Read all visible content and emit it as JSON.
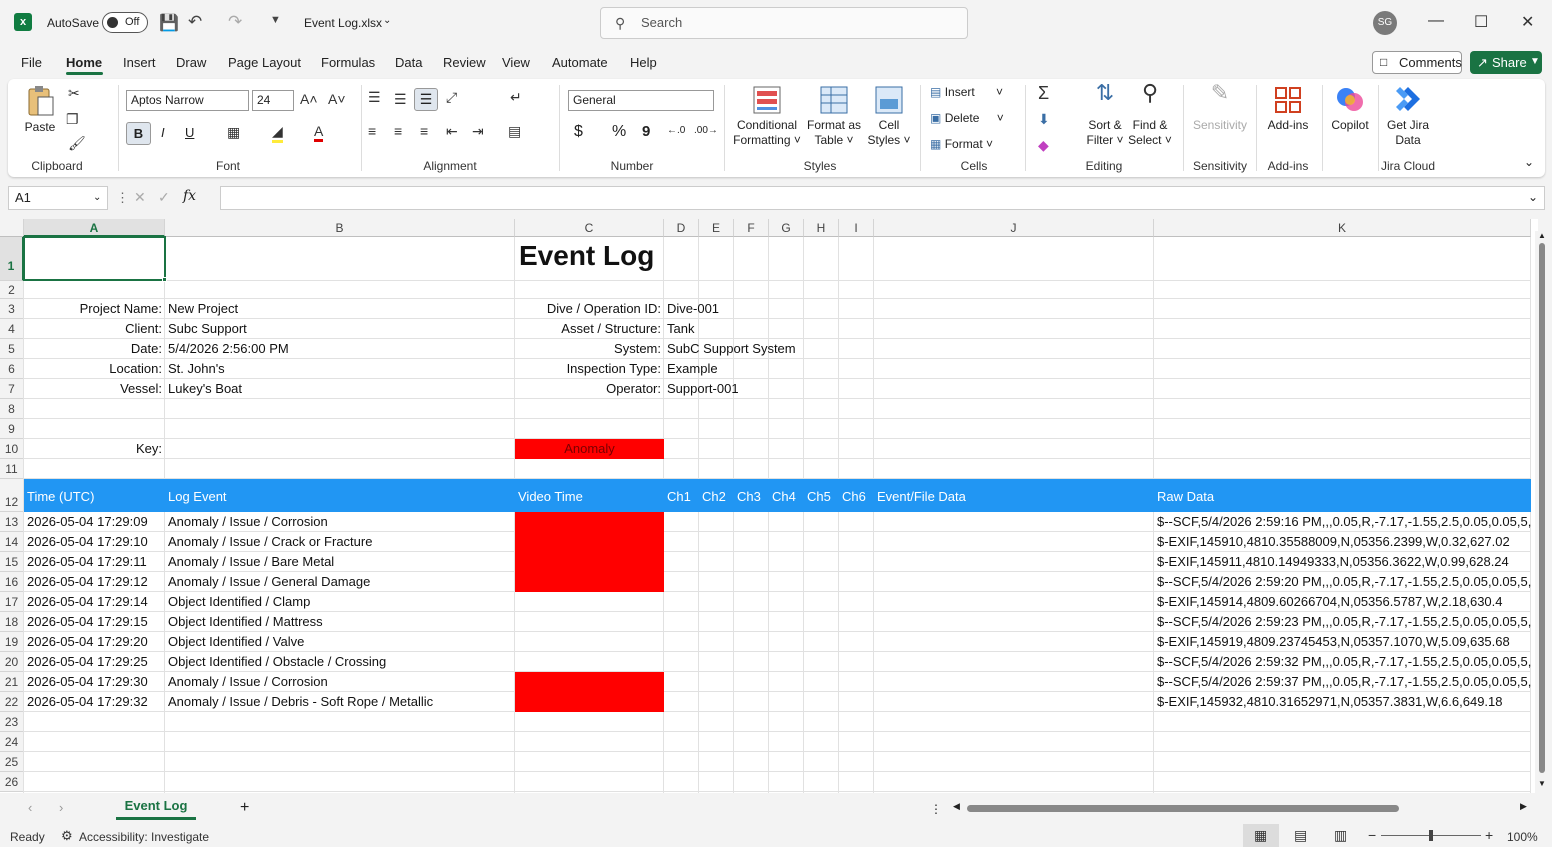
{
  "app": {
    "autosave_label": "AutoSave",
    "autosave_state": "Off",
    "file_name": "Event Log.xlsx",
    "search_placeholder": "Search",
    "user_initials": "SG"
  },
  "menu": {
    "items": [
      "File",
      "Home",
      "Insert",
      "Draw",
      "Page Layout",
      "Formulas",
      "Data",
      "Review",
      "View",
      "Automate",
      "Help"
    ],
    "comments": "Comments",
    "share": "Share"
  },
  "ribbon": {
    "clipboard": {
      "paste": "Paste",
      "label": "Clipboard"
    },
    "font": {
      "name": "Aptos Narrow",
      "size": "24",
      "bold": "B",
      "italic": "I",
      "underline": "U",
      "label": "Font"
    },
    "alignment": {
      "label": "Alignment"
    },
    "number": {
      "format": "General",
      "currency": "$",
      "percent": "%",
      "comma": "9",
      "label": "Number"
    },
    "styles": {
      "conditional": "Conditional",
      "conditional2": "Formatting",
      "format_as": "Format as",
      "format_as2": "Table",
      "cell": "Cell",
      "cell2": "Styles",
      "label": "Styles"
    },
    "cells": {
      "insert": "Insert",
      "delete": "Delete",
      "format": "Format",
      "label": "Cells"
    },
    "editing": {
      "sort": "Sort &",
      "sort2": "Filter",
      "find": "Find &",
      "find2": "Select",
      "label": "Editing"
    },
    "sensitivity": {
      "btn": "Sensitivity",
      "label": "Sensitivity"
    },
    "addins": {
      "btn": "Add-ins",
      "label": "Add-ins"
    },
    "copilot": {
      "btn": "Copilot"
    },
    "jira": {
      "btn": "Get Jira",
      "btn2": "Data",
      "label": "Jira Cloud"
    }
  },
  "formula_bar": {
    "name_box": "A1",
    "fx": "fx"
  },
  "columns": [
    "A",
    "B",
    "C",
    "D",
    "E",
    "F",
    "G",
    "H",
    "I",
    "J",
    "K"
  ],
  "rows": [
    "1",
    "2",
    "3",
    "4",
    "5",
    "6",
    "7",
    "8",
    "9",
    "10",
    "11",
    "12",
    "13",
    "14",
    "15",
    "16",
    "17",
    "18",
    "19",
    "20",
    "21",
    "22",
    "23",
    "24",
    "25",
    "26"
  ],
  "sheet": {
    "title": "Event Log",
    "meta_left": [
      [
        "Project Name:",
        "New Project"
      ],
      [
        "Client:",
        "Subc Support"
      ],
      [
        "Date:",
        "5/4/2026 2:56:00 PM"
      ],
      [
        "Location:",
        "St. John's"
      ],
      [
        "Vessel:",
        "Lukey's Boat"
      ]
    ],
    "meta_right": [
      [
        "Dive / Operation ID:",
        "Dive-001"
      ],
      [
        "Asset / Structure:",
        "Tank"
      ],
      [
        "System:",
        "SubC Support System"
      ],
      [
        "Inspection Type:",
        "Example"
      ],
      [
        "Operator:",
        "Support-001"
      ]
    ],
    "key_label": "Key:",
    "key_value": "Anomaly",
    "headers": [
      "Time (UTC)",
      "Log Event",
      "Video Time",
      "Ch1",
      "Ch2",
      "Ch3",
      "Ch4",
      "Ch5",
      "Ch6",
      "Event/File Data",
      "Raw Data"
    ],
    "rows": [
      [
        "2026-05-04 17:29:09",
        "Anomaly / Issue / Corrosion",
        "$--SCF,5/4/2026 2:59:16 PM,,,0.05,R,-7.17,-1.55,2.5,0.05,0.05,5,"
      ],
      [
        "2026-05-04 17:29:10",
        "Anomaly / Issue / Crack or Fracture",
        "$-EXIF,145910,4810.35588009,N,05356.2399,W,0.32,627.02"
      ],
      [
        "2026-05-04 17:29:11",
        "Anomaly / Issue / Bare Metal",
        "$-EXIF,145911,4810.14949333,N,05356.3622,W,0.99,628.24"
      ],
      [
        "2026-05-04 17:29:12",
        "Anomaly / Issue / General Damage",
        "$--SCF,5/4/2026 2:59:20 PM,,,0.05,R,-7.17,-1.55,2.5,0.05,0.05,5,"
      ],
      [
        "2026-05-04 17:29:14",
        "Object Identified / Clamp",
        "$-EXIF,145914,4809.60266704,N,05356.5787,W,2.18,630.4"
      ],
      [
        "2026-05-04 17:29:15",
        "Object Identified / Mattress",
        "$--SCF,5/4/2026 2:59:23 PM,,,0.05,R,-7.17,-1.55,2.5,0.05,0.05,5,"
      ],
      [
        "2026-05-04 17:29:20",
        "Object Identified / Valve",
        "$-EXIF,145919,4809.23745453,N,05357.1070,W,5.09,635.68"
      ],
      [
        "2026-05-04 17:29:25",
        "Object Identified / Obstacle / Crossing",
        "$--SCF,5/4/2026 2:59:32 PM,,,0.05,R,-7.17,-1.55,2.5,0.05,0.05,5,"
      ],
      [
        "2026-05-04 17:29:30",
        "Anomaly / Issue / Corrosion",
        "$--SCF,5/4/2026 2:59:37 PM,,,0.05,R,-7.17,-1.55,2.5,0.05,0.05,5,"
      ],
      [
        "2026-05-04 17:29:32",
        "Anomaly / Issue / Debris - Soft Rope / Metallic",
        "$-EXIF,145932,4810.31652971,N,05357.3831,W,6.6,649.18"
      ]
    ]
  },
  "tabs": {
    "active": "Event Log"
  },
  "status": {
    "ready": "Ready",
    "accessibility": "Accessibility: Investigate",
    "zoom": "100%"
  },
  "colors": {
    "accent": "#1a7343",
    "header_band": "#2196f3",
    "anomaly": "#ff0000"
  }
}
